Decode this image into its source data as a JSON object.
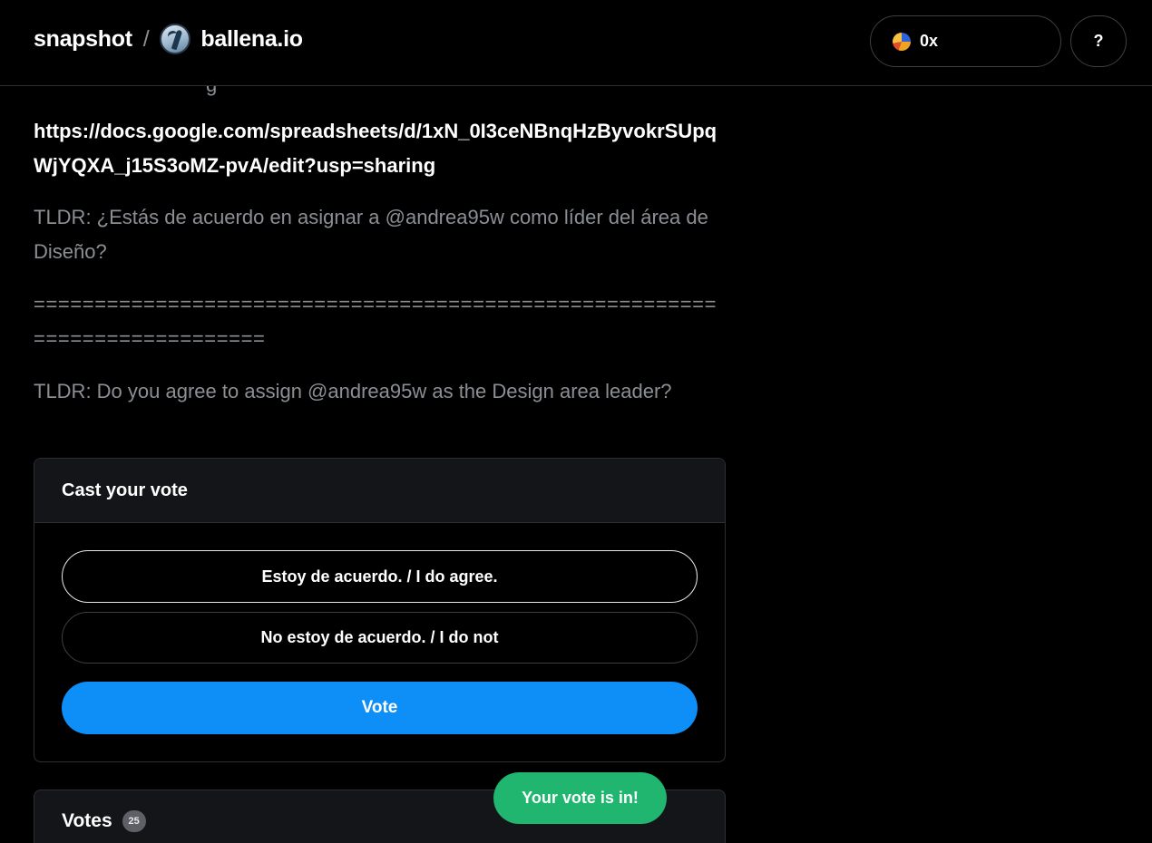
{
  "header": {
    "brand": "snapshot",
    "separator": "/",
    "space_name": "ballena.io",
    "account_label": "0x",
    "help_label": "?"
  },
  "proposal": {
    "partial_text": "g",
    "url": "https://docs.google.com/spreadsheets/d/1xN_0I3ceNBnqHzByvokrSUpqWjYQXA_j15S3oMZ-pvA/edit?usp=sharing",
    "tldr_es": "TLDR: ¿Estás de acuerdo en asignar a @andrea95w como líder del área de Diseño?",
    "divider": "===========================================================================",
    "tldr_en": "TLDR: Do you agree to assign @andrea95w as the Design area leader?"
  },
  "vote_card": {
    "title": "Cast your vote",
    "choices": [
      {
        "label": "Estoy de acuerdo. / I do agree.",
        "selected": true
      },
      {
        "label": "No estoy de acuerdo. / I do not",
        "selected": false
      }
    ],
    "vote_button": "Vote"
  },
  "votes_card": {
    "title": "Votes",
    "count": "25"
  },
  "toast": {
    "message": "Your vote is in!"
  },
  "colors": {
    "background": "#000000",
    "card_header": "#141518",
    "border": "#2d2f33",
    "primary": "#0d8ff7",
    "success": "#21b66f",
    "muted_text": "#8b8f94"
  }
}
